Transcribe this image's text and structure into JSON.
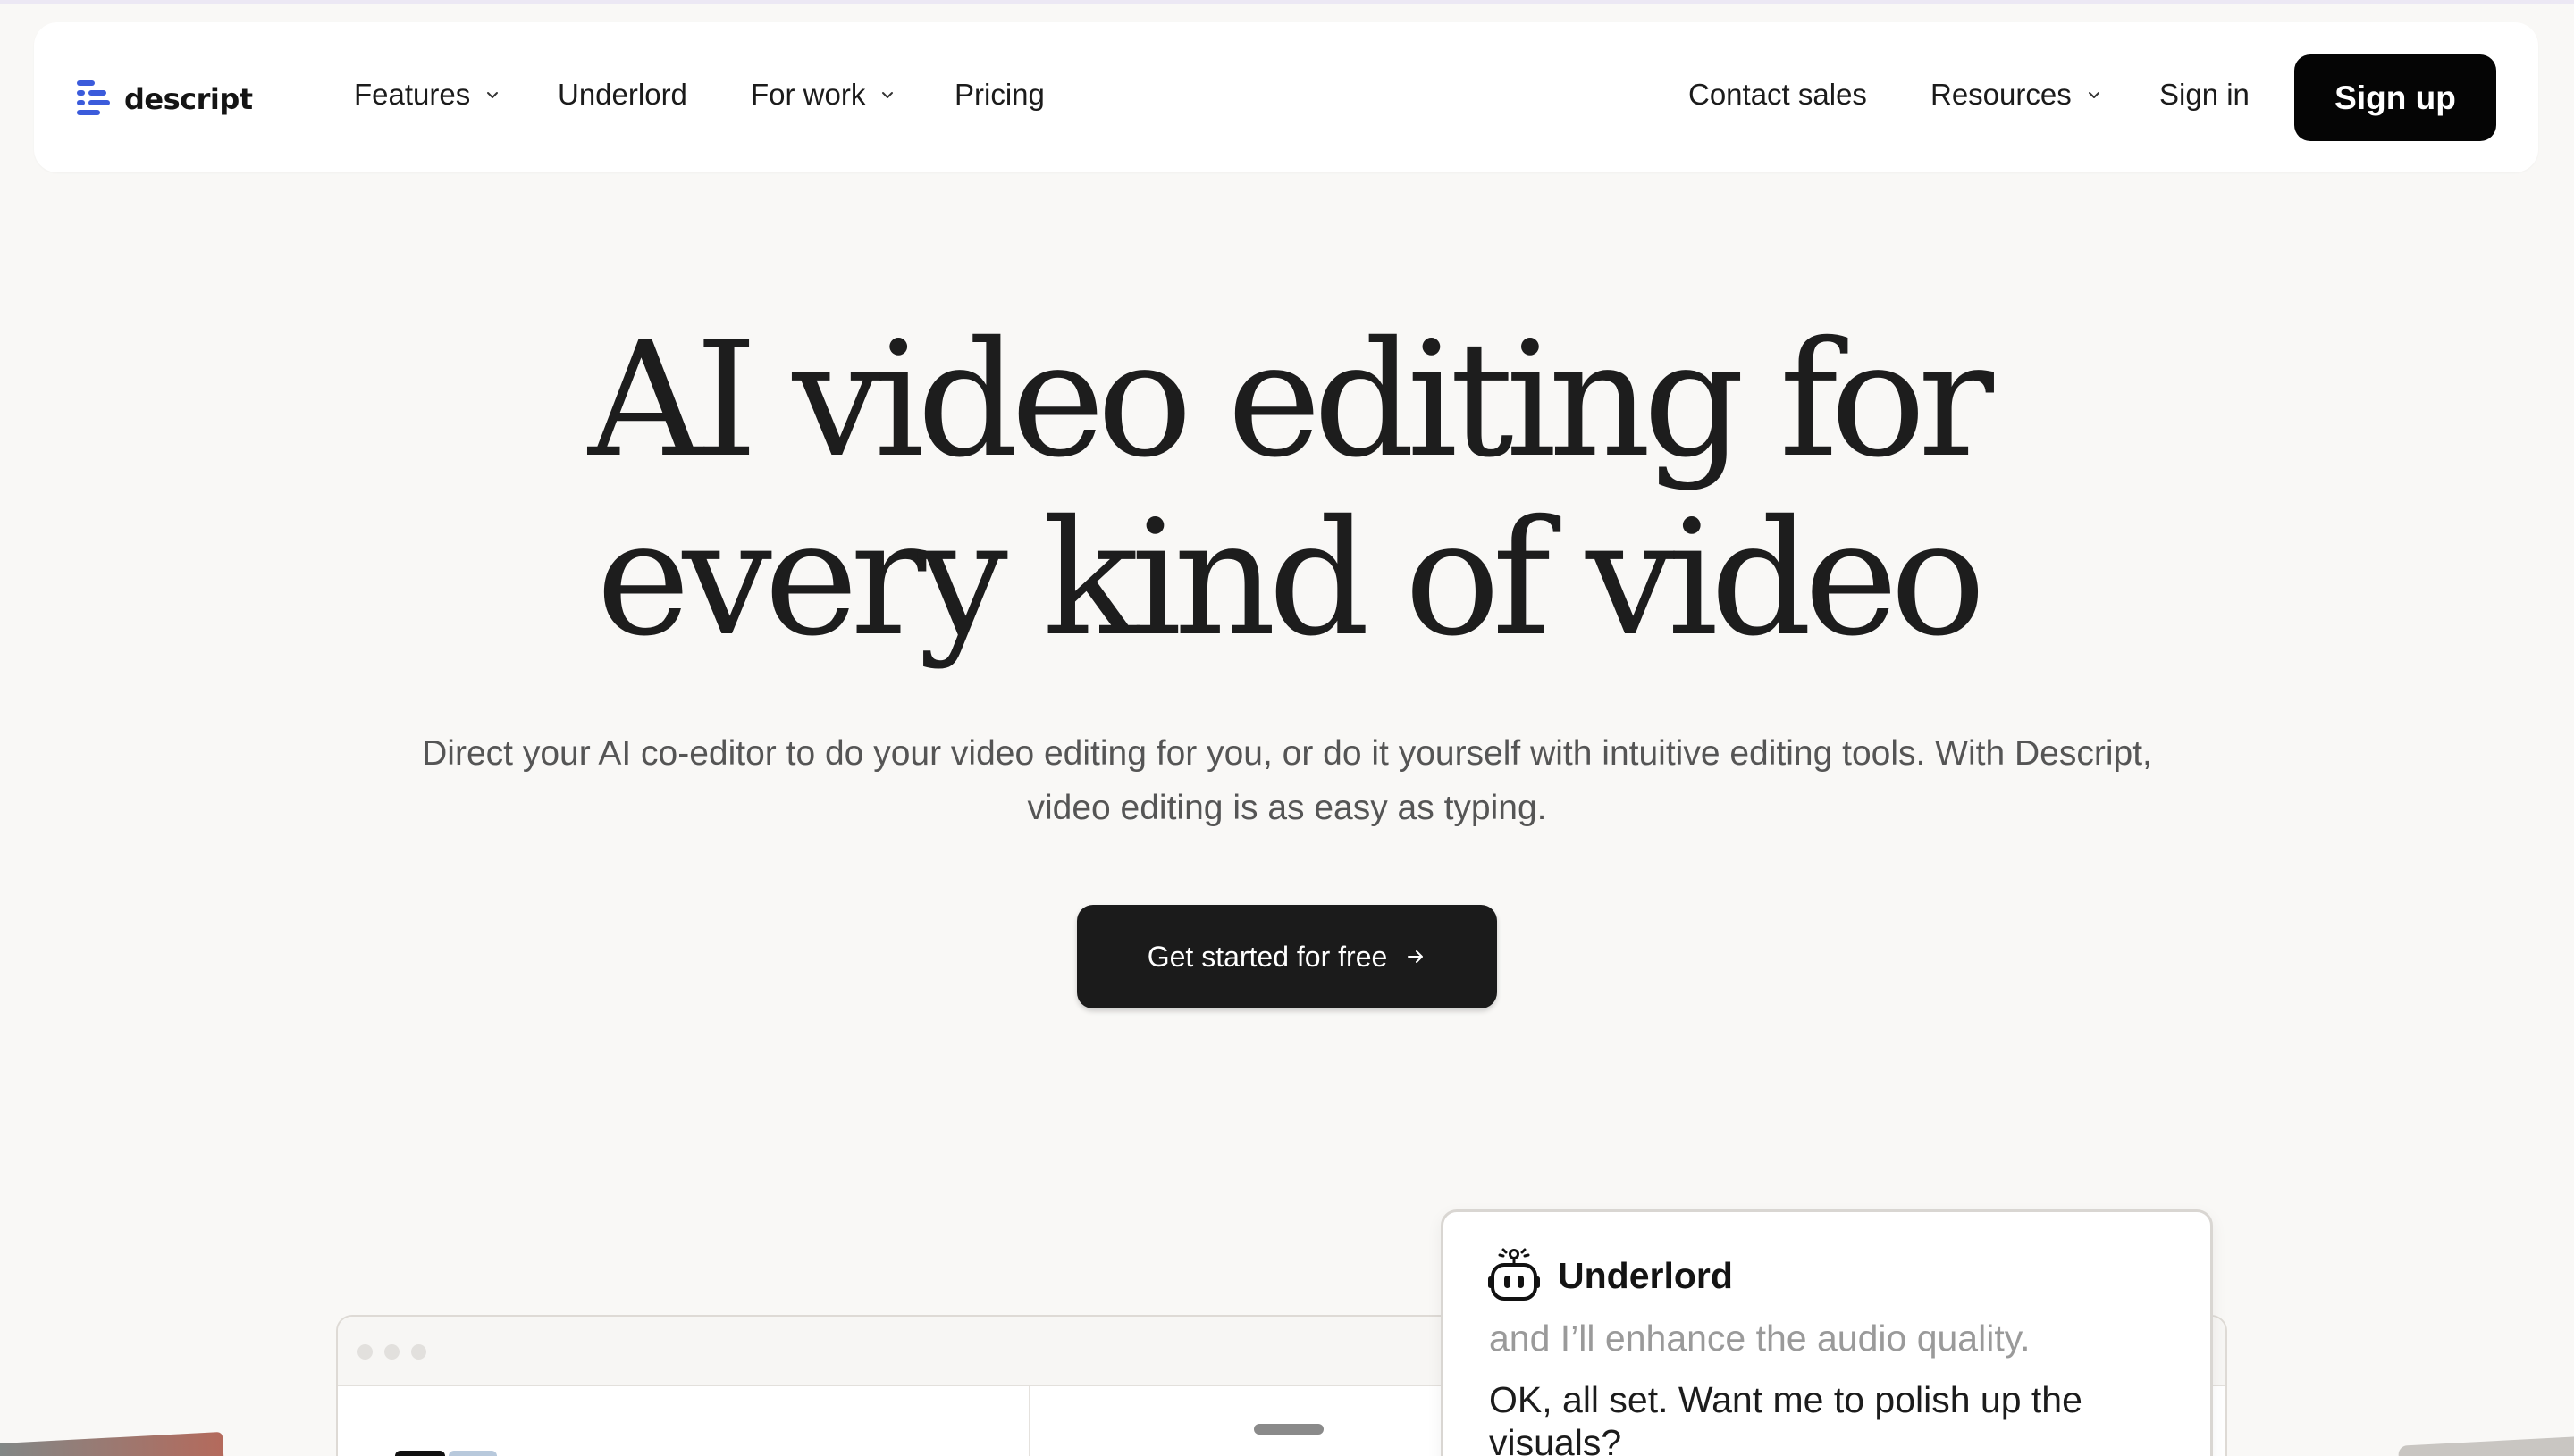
{
  "brand": {
    "name": "descript",
    "accent": "#3b5bdb"
  },
  "nav": {
    "features": "Features",
    "underlord": "Underlord",
    "for_work": "For work",
    "pricing": "Pricing",
    "contact_sales": "Contact sales",
    "resources": "Resources",
    "sign_in": "Sign in",
    "sign_up": "Sign up"
  },
  "hero": {
    "title_line1": "AI video editing for",
    "title_line2": "every kind of video",
    "subtitle": "Direct your AI co-editor to do your video editing for you, or do it yourself with intuitive editing tools. With Descript, video editing is as easy as typing.",
    "cta": "Get started for free"
  },
  "underlord_card": {
    "title": "Underlord",
    "previous_message": "and I’ll enhance the audio quality.",
    "current_message": "OK, all set. Want me to polish up the visuals?"
  },
  "icons": {
    "logo": "descript-logo-icon",
    "chevron": "chevron-down-icon",
    "arrow": "arrow-right-icon",
    "robot": "robot-icon"
  }
}
